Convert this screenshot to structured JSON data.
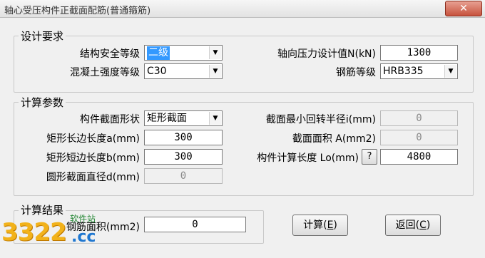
{
  "window": {
    "title": "轴心受压构件正截面配筋(普通箍筋)",
    "close_glyph": "✕"
  },
  "design": {
    "legend": "设计要求",
    "safety_level_label": "结构安全等级",
    "safety_level_value": "二级",
    "axial_force_label": "轴向压力设计值N(kN)",
    "axial_force_value": "1300",
    "concrete_label": "混凝土强度等级",
    "concrete_value": "C30",
    "rebar_label": "钢筋等级",
    "rebar_value": "HRB335"
  },
  "calc": {
    "legend": "计算参数",
    "shape_label": "构件截面形状",
    "shape_value": "矩形截面",
    "min_radius_label": "截面最小回转半径i(mm)",
    "min_radius_value": "0",
    "long_side_label": "矩形长边长度a(mm)",
    "long_side_value": "300",
    "area_label": "截面面积 A(mm2)",
    "area_value": "0",
    "short_side_label": "矩形短边长度b(mm)",
    "short_side_value": "300",
    "calc_length_label": "构件计算长度 Lo(mm)",
    "help_label": "?",
    "calc_length_value": "4800",
    "diameter_label": "圆形截面直径d(mm)",
    "diameter_value": "0"
  },
  "result": {
    "legend": "计算结果",
    "rebar_area_label": "钢筋面积(mm2)",
    "rebar_area_value": "0"
  },
  "buttons": {
    "calculate_text": "计算(",
    "calculate_key": "E",
    "calculate_end": ")",
    "back_text": "返回(",
    "back_key": "C",
    "back_end": ")"
  },
  "watermark": {
    "number": "3322",
    "domain": ".cc",
    "site": "软件站"
  },
  "icons": {
    "dropdown": "chevron-down-icon"
  }
}
